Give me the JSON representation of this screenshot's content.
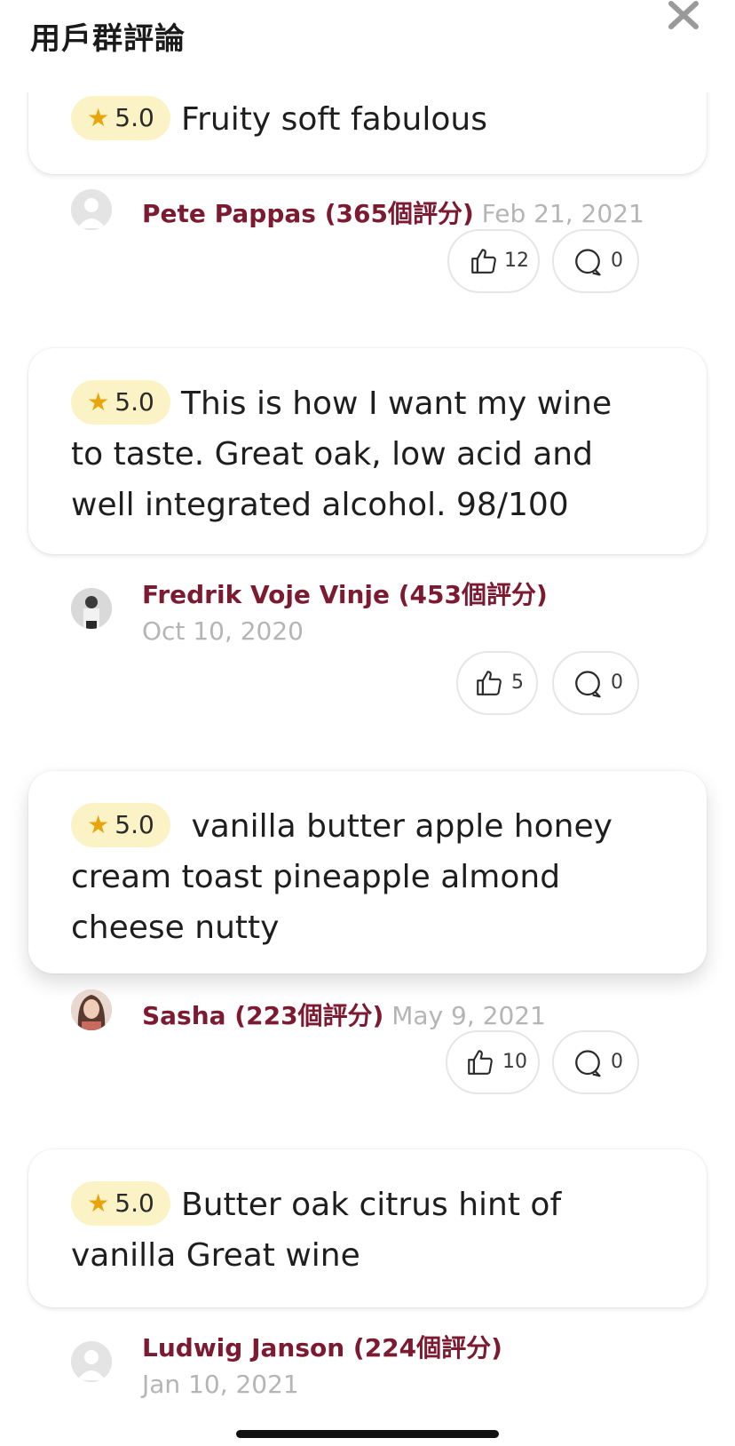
{
  "header": {
    "title": "用戶群評論",
    "close_icon": "close-icon"
  },
  "reviews": [
    {
      "rating": "5.0",
      "text": "Fruity soft fabulous",
      "author": "Pete Pappas (365個評分)",
      "date": "Feb 21, 2021",
      "likes": "12",
      "comments": "0",
      "avatar": "placeholder-avatar"
    },
    {
      "rating": "5.0",
      "text": "This is how I want my wine to taste. Great oak, low acid and well integrated alcohol. 98/100",
      "author": "Fredrik Voje Vinje (453個評分)",
      "date": "Oct 10, 2020",
      "likes": "5",
      "comments": "0",
      "avatar": "photo-avatar"
    },
    {
      "rating": "5.0",
      "text": " vanilla butter apple honey cream toast pineapple almond cheese nutty",
      "author": "Sasha (223個評分)",
      "date": "May 9, 2021",
      "likes": "10",
      "comments": "0",
      "avatar": "photo-avatar"
    },
    {
      "rating": "5.0",
      "text": "Butter oak citrus hint of vanilla Great wine",
      "author": "Ludwig Janson (224個評分)",
      "date": "Jan 10, 2021",
      "avatar": "placeholder-avatar"
    }
  ],
  "colors": {
    "author": "#7b1a30",
    "date": "#b5b5b5",
    "star": "#e8a40c",
    "rating_pill_bg": "#fbf3c6"
  }
}
